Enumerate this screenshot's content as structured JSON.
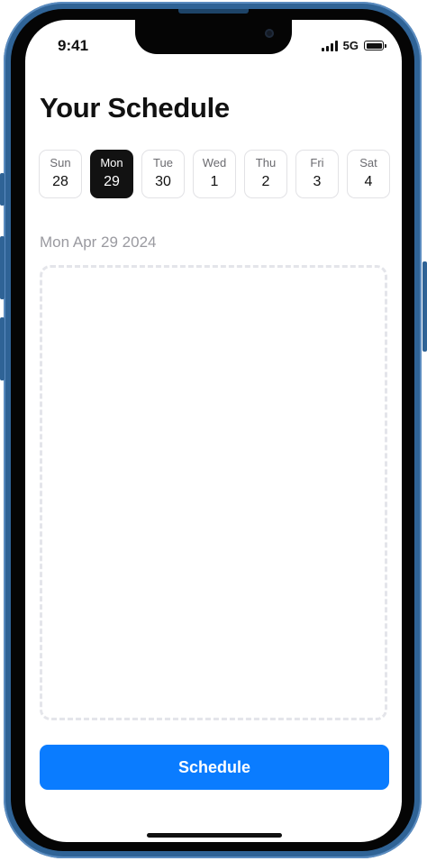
{
  "status_bar": {
    "time": "9:41",
    "network": "5G"
  },
  "page": {
    "title": "Your Schedule",
    "selected_date": "Mon Apr 29 2024"
  },
  "days": [
    {
      "name": "Sun",
      "num": "28",
      "selected": false
    },
    {
      "name": "Mon",
      "num": "29",
      "selected": true
    },
    {
      "name": "Tue",
      "num": "30",
      "selected": false
    },
    {
      "name": "Wed",
      "num": "1",
      "selected": false
    },
    {
      "name": "Thu",
      "num": "2",
      "selected": false
    },
    {
      "name": "Fri",
      "num": "3",
      "selected": false
    },
    {
      "name": "Sat",
      "num": "4",
      "selected": false
    }
  ],
  "actions": {
    "schedule_label": "Schedule"
  },
  "colors": {
    "accent": "#0a7cff",
    "selected_day": "#121212",
    "phone_frame": "#2f6396"
  },
  "icons": [
    "signal-icon",
    "battery-icon",
    "camera-icon"
  ]
}
